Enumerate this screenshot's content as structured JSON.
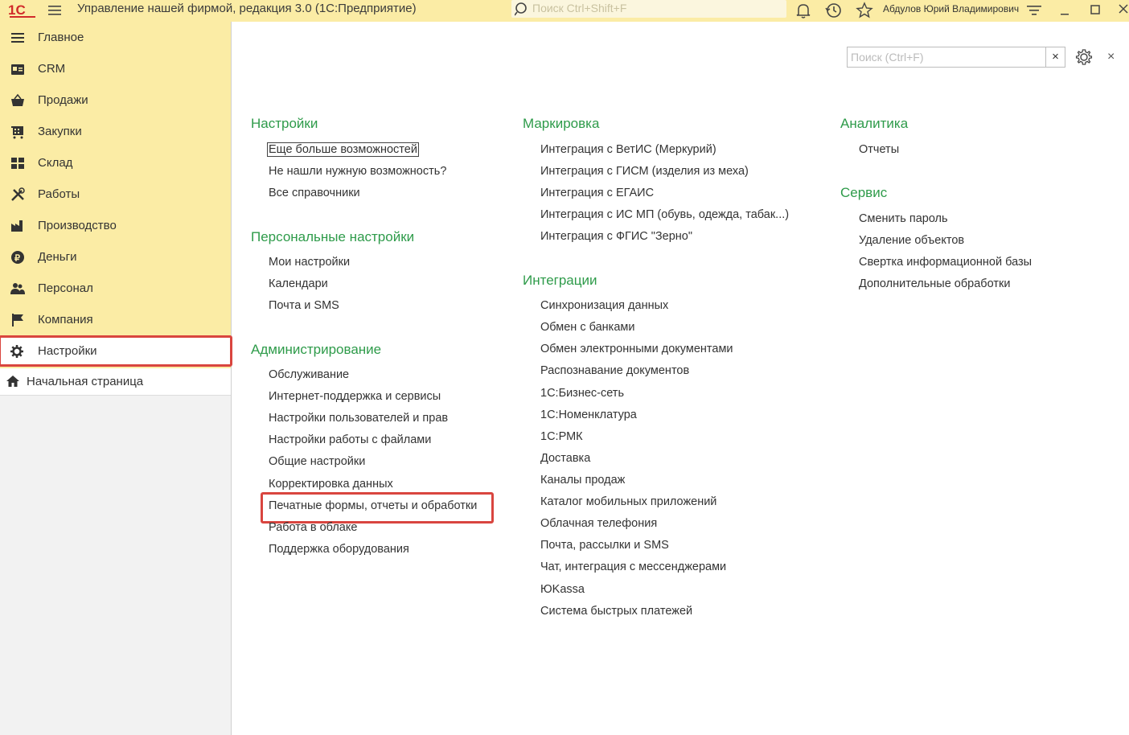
{
  "app": {
    "title": "Управление нашей фирмой, редакция 3.0  (1С:Предприятие)",
    "global_search_placeholder": "Поиск Ctrl+Shift+F",
    "user": "Абдулов Юрий Владимирович"
  },
  "colors": {
    "accent_yellow": "#fbeca5",
    "group_green": "#2e9b4a",
    "highlight_red": "#d9453f"
  },
  "sidebar": {
    "items": [
      {
        "label": "Главное",
        "icon": "menu-lines-icon"
      },
      {
        "label": "CRM",
        "icon": "crm-card-icon"
      },
      {
        "label": "Продажи",
        "icon": "basket-icon"
      },
      {
        "label": "Закупки",
        "icon": "cart-icon"
      },
      {
        "label": "Склад",
        "icon": "warehouse-icon"
      },
      {
        "label": "Работы",
        "icon": "tools-icon"
      },
      {
        "label": "Производство",
        "icon": "factory-icon"
      },
      {
        "label": "Деньги",
        "icon": "ruble-icon"
      },
      {
        "label": "Персонал",
        "icon": "people-icon"
      },
      {
        "label": "Компания",
        "icon": "flag-icon"
      },
      {
        "label": "Настройки",
        "icon": "gear-icon",
        "active": true
      }
    ],
    "home": "Начальная страница"
  },
  "main": {
    "search_placeholder": "Поиск (Ctrl+F)",
    "search_clear": "×",
    "close": "×",
    "columns": [
      {
        "groups": [
          {
            "title": "Настройки",
            "links": [
              "Еще больше возможностей",
              "Не нашли нужную возможность?",
              "Все справочники"
            ]
          },
          {
            "title": "Персональные настройки",
            "links": [
              "Мои настройки",
              "Календари",
              "Почта и SMS"
            ]
          },
          {
            "title": "Администрирование",
            "links": [
              "Обслуживание",
              "Интернет-поддержка и сервисы",
              "Настройки пользователей и прав",
              "Настройки работы с файлами",
              "Общие настройки",
              "Корректировка данных",
              "Печатные формы, отчеты и обработки",
              "Работа в облаке",
              "Поддержка оборудования"
            ]
          }
        ]
      },
      {
        "groups": [
          {
            "title": "Маркировка",
            "links": [
              "Интеграция с ВетИС (Меркурий)",
              "Интеграция с ГИСМ (изделия из меха)",
              "Интеграция с ЕГАИС",
              "Интеграция с ИС МП (обувь, одежда, табак...)",
              "Интеграция с ФГИС \"Зерно\""
            ]
          },
          {
            "title": "Интеграции",
            "links": [
              "Синхронизация данных",
              "Обмен с банками",
              "Обмен электронными документами",
              "Распознавание документов",
              "1С:Бизнес-сеть",
              "1С:Номенклатура",
              "1С:РМК",
              "Доставка",
              "Каналы продаж",
              "Каталог мобильных приложений",
              "Облачная телефония",
              "Почта, рассылки и SMS",
              "Чат, интеграция с мессенджерами",
              "ЮKassa",
              "Система быстрых платежей"
            ]
          }
        ]
      },
      {
        "groups": [
          {
            "title": "Аналитика",
            "links": [
              "Отчеты"
            ]
          },
          {
            "title": "Сервис",
            "links": [
              "Сменить пароль",
              "Удаление объектов",
              "Свертка информационной базы",
              "Дополнительные обработки"
            ]
          }
        ]
      }
    ]
  }
}
